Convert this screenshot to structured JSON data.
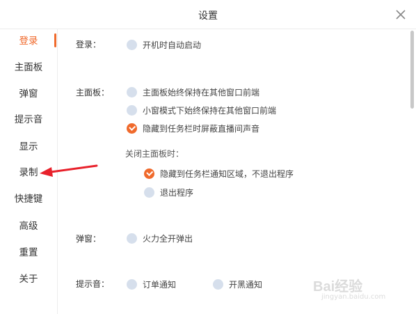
{
  "window": {
    "title": "设置"
  },
  "sidebar": {
    "items": [
      {
        "label": "登录"
      },
      {
        "label": "主面板"
      },
      {
        "label": "弹窗"
      },
      {
        "label": "提示音"
      },
      {
        "label": "显示"
      },
      {
        "label": "录制"
      },
      {
        "label": "快捷键"
      },
      {
        "label": "高级"
      },
      {
        "label": "重置"
      },
      {
        "label": "关于"
      }
    ],
    "active_index": 0
  },
  "sections": {
    "login": {
      "label": "登录：",
      "options": [
        {
          "label": "开机时自动启动",
          "checked": false
        }
      ]
    },
    "main_panel": {
      "label": "主面板：",
      "options": [
        {
          "label": "主面板始终保持在其他窗口前端",
          "checked": false
        },
        {
          "label": "小窗模式下始终保持在其他窗口前端",
          "checked": false
        },
        {
          "label": "隐藏到任务栏时屏蔽直播间声音",
          "checked": true
        }
      ],
      "close_label": "关闭主面板时：",
      "close_options": [
        {
          "label": "隐藏到任务栏通知区域，不退出程序",
          "checked": true
        },
        {
          "label": "退出程序",
          "checked": false
        }
      ]
    },
    "popup": {
      "label": "弹窗：",
      "options": [
        {
          "label": "火力全开弹出",
          "checked": false
        }
      ]
    },
    "sound": {
      "label": "提示音：",
      "options": [
        {
          "label": "订单通知",
          "checked": false
        },
        {
          "label": "开黑通知",
          "checked": false
        }
      ]
    }
  },
  "watermark": {
    "text": "Bai经验",
    "url": "jingyan.baidu.com"
  },
  "colors": {
    "accent": "#f06a2c",
    "radio_unchecked": "#d6dfec",
    "annotation_arrow": "#e8212b"
  }
}
